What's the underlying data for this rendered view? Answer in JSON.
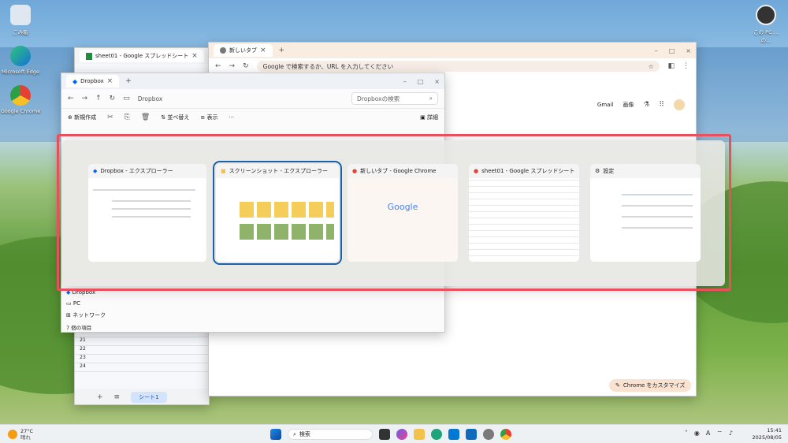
{
  "desktop": {
    "icons": [
      {
        "label": "ごみ箱",
        "name": "recycle-bin-icon"
      },
      {
        "label": "Microsoft Edge",
        "name": "edge-icon"
      },
      {
        "label": "Google Chrome",
        "name": "chrome-icon"
      }
    ],
    "right_icon_label": "この PC ...\nの..."
  },
  "chrome_window": {
    "tab_title": "新しいタブ",
    "omnibox_placeholder": "Google で検索するか、URL を入力してください",
    "links": [
      "Gmail",
      "画像"
    ],
    "customize_button": "Chrome をカスタマイズ"
  },
  "sheets_window": {
    "tab_title": "sheet01 - Google スプレッドシート",
    "rows": [
      "20",
      "21",
      "22",
      "23",
      "24"
    ],
    "sheet_tab": "シート1"
  },
  "explorer_window": {
    "tab_title": "Dropbox",
    "breadcrumb": "Dropbox",
    "search_placeholder": "Dropboxの検索",
    "toolbar": {
      "new": "新規作成",
      "sort": "並べ替え",
      "view": "表示",
      "details": "詳細"
    },
    "nav": [
      "Dropbox",
      "PC",
      "ネットワーク"
    ],
    "status": "7 個の項目"
  },
  "switcher": {
    "cards": [
      {
        "title": "Dropbox - エクスプローラー",
        "icon": "dropbox-icon"
      },
      {
        "title": "スクリーンショット - エクスプローラー",
        "icon": "folder-icon"
      },
      {
        "title": "新しいタブ - Google Chrome",
        "icon": "chrome-icon"
      },
      {
        "title": "sheet01 - Google スプレッドシート - Google...",
        "icon": "chrome-icon"
      },
      {
        "title": "設定",
        "icon": "gear-icon"
      }
    ],
    "thumb_google": "Google"
  },
  "taskbar": {
    "weather_temp": "27°C",
    "weather_desc": "晴れ",
    "search_placeholder": "検索",
    "time": "15:41",
    "date": "2025/08/05"
  },
  "colors": {
    "highlight": "#e9505e",
    "selected": "#1d5fa8",
    "chrome_tint": "#f9ece0"
  }
}
